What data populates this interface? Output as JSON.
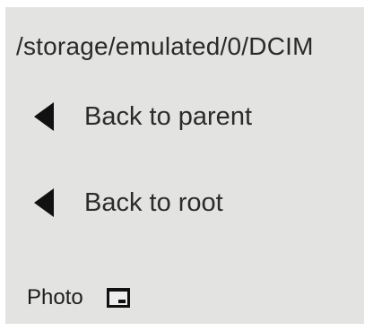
{
  "header": {
    "path": "/storage/emulated/0/DCIM"
  },
  "nav": {
    "back_parent": {
      "label": "Back to parent",
      "icon": "left-triangle-icon"
    },
    "back_root": {
      "label": "Back to root",
      "icon": "left-triangle-icon"
    }
  },
  "files": [
    {
      "name": "Photo",
      "icon": "folder-icon"
    }
  ]
}
